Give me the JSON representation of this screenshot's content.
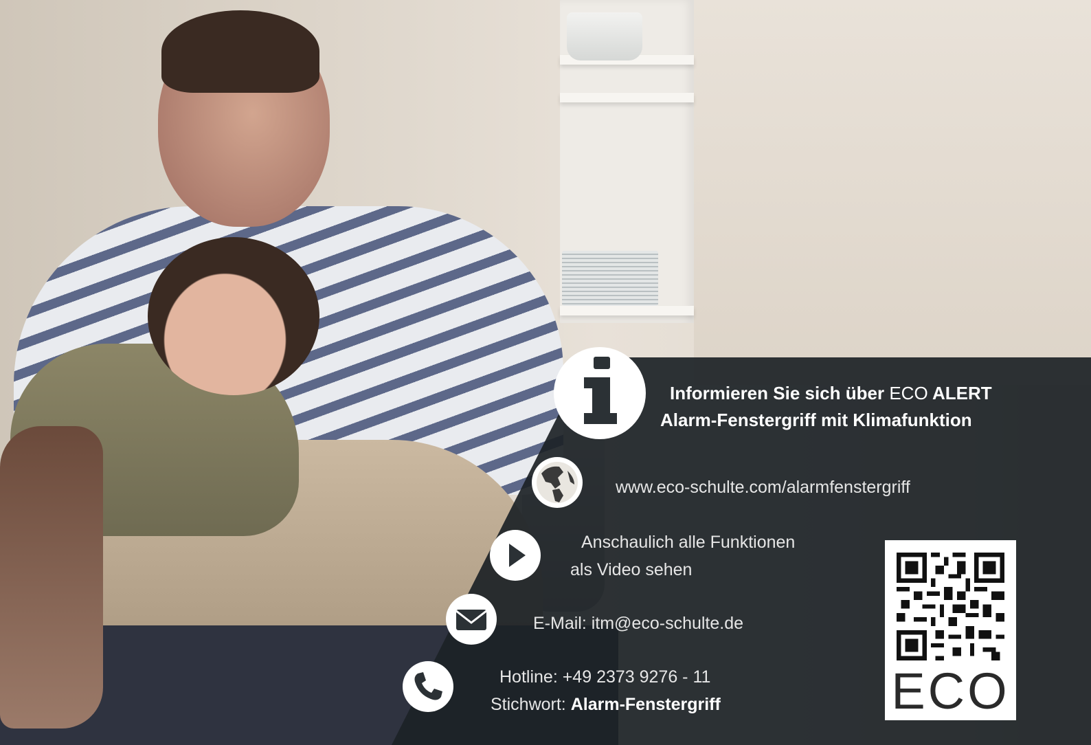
{
  "headline": {
    "line1_bold": "Informieren Sie sich über",
    "line1_brand": "ECO",
    "line1_product": "ALERT",
    "line2": "Alarm-Fenstergriff mit Klimafunktion"
  },
  "website": {
    "text": "www.eco-schulte.com/alarmfenstergriff",
    "icon": "globe-icon"
  },
  "video": {
    "line1": "Anschaulich alle Funktionen",
    "line2": "als Video sehen",
    "icon": "play-icon"
  },
  "email": {
    "text": "E-Mail: itm@eco-schulte.de",
    "icon": "mail-icon"
  },
  "hotline": {
    "line1": "Hotline: +49 2373  9276 - 11",
    "keyword_label": "Stichwort:",
    "keyword_value": "Alarm-Fenstergriff",
    "icon": "phone-icon"
  },
  "info_icon": "info-icon",
  "qr_logo": "ECO",
  "colors": {
    "overlay": "#1c2226",
    "icon_bg": "#ffffff",
    "text": "#e6e6e6"
  }
}
